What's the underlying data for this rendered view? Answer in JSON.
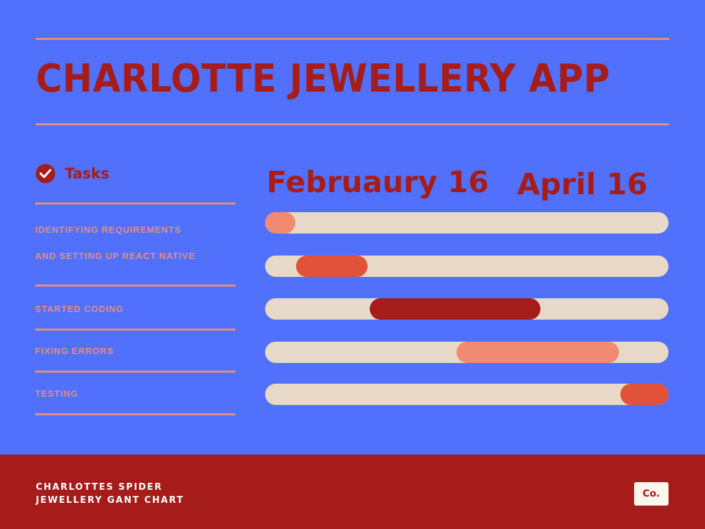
{
  "title": "CHARLOTTE JEWELLERY APP",
  "tasks_header": {
    "label": "Tasks",
    "icon": "check-circle-icon"
  },
  "tasks": [
    {
      "lines": [
        "IDENTIFYING REQUIREMENTS",
        "AND  SETTING UP REACT NATIVE"
      ]
    },
    {
      "lines": [
        "STARTED CODING"
      ]
    },
    {
      "lines": [
        "FIXING ERRORS"
      ]
    },
    {
      "lines": [
        "TESTING"
      ]
    }
  ],
  "chart_data": {
    "type": "gantt",
    "date_labels": [
      "Februaury 16",
      "April 16"
    ],
    "timeline": {
      "start_fraction": 0,
      "end_fraction": 1
    },
    "bars": [
      {
        "start": 0.0,
        "end": 0.075,
        "color": "#f08a71"
      },
      {
        "start": 0.077,
        "end": 0.254,
        "color": "#e0533a"
      },
      {
        "start": 0.259,
        "end": 0.683,
        "color": "#a61c1a"
      },
      {
        "start": 0.474,
        "end": 0.877,
        "color": "#f08a71"
      },
      {
        "start": 0.881,
        "end": 1.0,
        "color": "#e0533a"
      }
    ],
    "track_color": "#e8d8c8"
  },
  "footer": {
    "lines": [
      "CHARLOTTES SPIDER",
      "JEWELLERY GANT CHART"
    ],
    "badge": "Co."
  },
  "colors": {
    "background": "#5170fc",
    "accent_red": "#a61c1a",
    "rule_salmon": "#e48f7c",
    "footer": "#a61c1a"
  }
}
